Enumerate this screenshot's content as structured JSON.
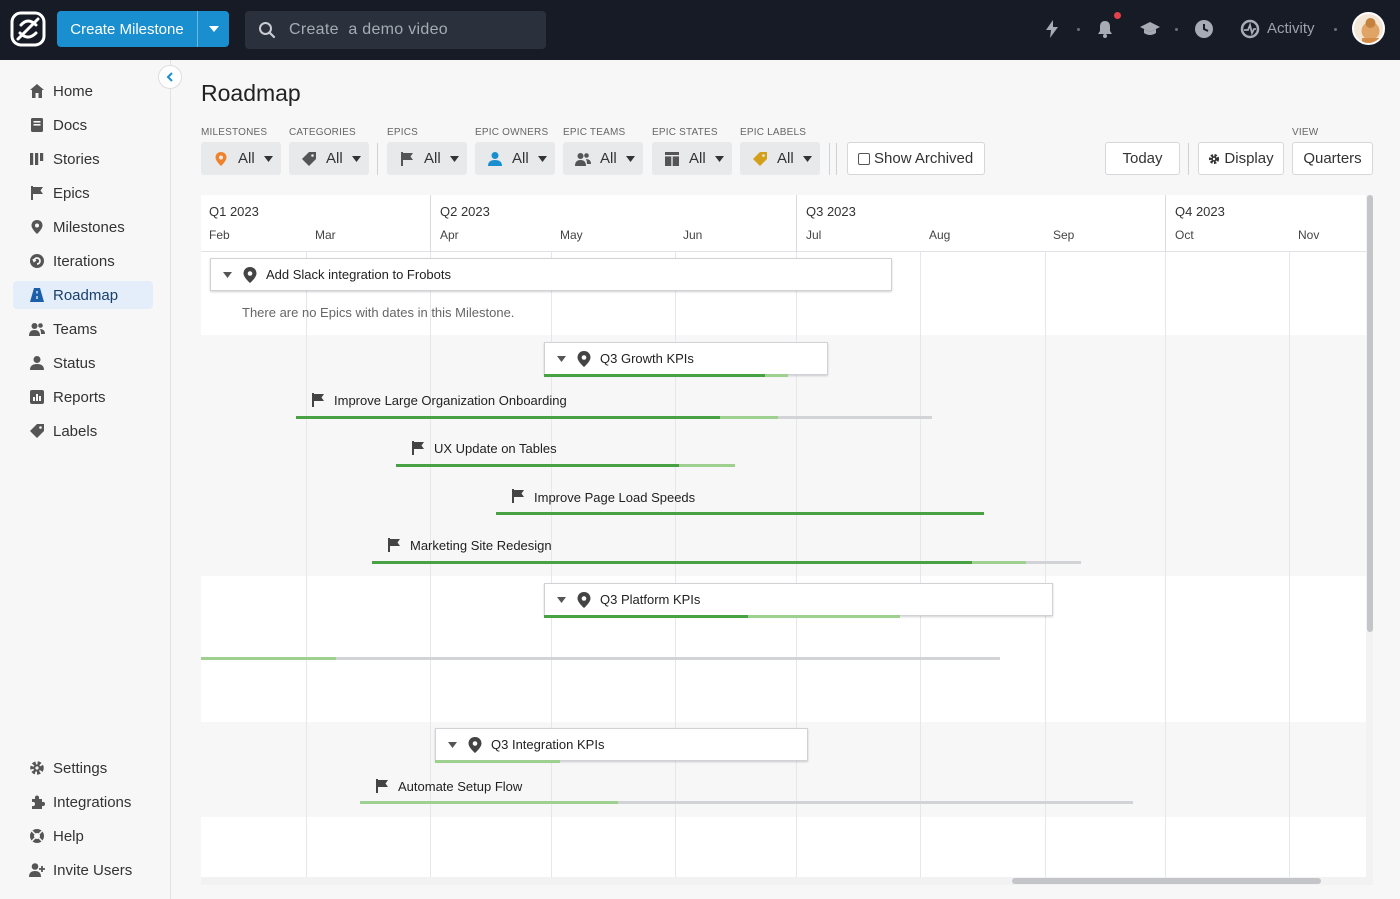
{
  "topbar": {
    "create_label": "Create Milestone",
    "search_placeholder": "Create  a demo video",
    "activity_label": "Activity"
  },
  "sidebar": {
    "items": [
      {
        "label": "Home",
        "icon": "home-icon"
      },
      {
        "label": "Docs",
        "icon": "docs-icon"
      },
      {
        "label": "Stories",
        "icon": "stories-icon"
      },
      {
        "label": "Epics",
        "icon": "flag-icon"
      },
      {
        "label": "Milestones",
        "icon": "milestone-pin-icon"
      },
      {
        "label": "Iterations",
        "icon": "iterations-icon"
      },
      {
        "label": "Roadmap",
        "icon": "roadmap-icon",
        "active": true
      },
      {
        "label": "Teams",
        "icon": "teams-icon"
      },
      {
        "label": "Status",
        "icon": "status-icon"
      },
      {
        "label": "Reports",
        "icon": "reports-icon"
      },
      {
        "label": "Labels",
        "icon": "labels-icon"
      }
    ],
    "bottom_items": [
      {
        "label": "Settings",
        "icon": "gear-icon"
      },
      {
        "label": "Integrations",
        "icon": "puzzle-icon"
      },
      {
        "label": "Help",
        "icon": "help-icon"
      },
      {
        "label": "Invite Users",
        "icon": "add-user-icon"
      }
    ]
  },
  "page": {
    "title": "Roadmap",
    "filters": [
      {
        "label": "MILESTONES",
        "value": "All"
      },
      {
        "label": "CATEGORIES",
        "value": "All"
      },
      {
        "label": "EPICS",
        "value": "All"
      },
      {
        "label": "EPIC OWNERS",
        "value": "All"
      },
      {
        "label": "EPIC TEAMS",
        "value": "All"
      },
      {
        "label": "EPIC STATES",
        "value": "All"
      },
      {
        "label": "EPIC LABELS",
        "value": "All"
      }
    ],
    "show_archived": "Show Archived",
    "today": "Today",
    "display": "Display",
    "view_label": "VIEW",
    "view_value": "Quarters"
  },
  "timeline": {
    "quarters": [
      "Q1 2023",
      "Q2 2023",
      "Q3 2023",
      "Q4 2023"
    ],
    "months": [
      "Feb",
      "Mar",
      "Apr",
      "May",
      "Jun",
      "Jul",
      "Aug",
      "Sep",
      "Oct",
      "Nov"
    ],
    "empty_note": "There are no Epics with dates in this Milestone.",
    "milestones": [
      {
        "name": "Add Slack integration to Frobots"
      },
      {
        "name": "Q3 Growth KPIs"
      },
      {
        "name": "Q3 Platform KPIs"
      },
      {
        "name": "Q3 Integration KPIs"
      }
    ],
    "epics": [
      {
        "name": "Improve Large Organization Onboarding"
      },
      {
        "name": "UX Update on Tables"
      },
      {
        "name": "Improve Page Load Speeds"
      },
      {
        "name": "Marketing Site Redesign"
      },
      {
        "name": "Automate Setup Flow"
      }
    ]
  },
  "colors": {
    "topbar": "#161b26",
    "accent": "#1a8fd0",
    "progress_done": "#48a243",
    "progress_started": "#9ed08f"
  }
}
